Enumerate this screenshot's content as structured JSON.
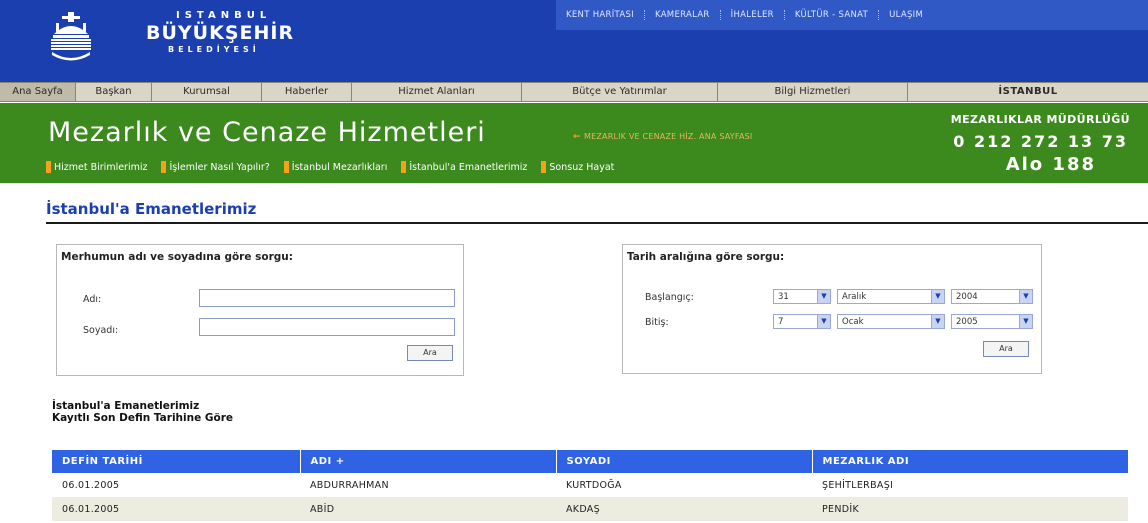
{
  "header": {
    "brand_line1": "ISTANBUL",
    "brand_line2": "BÜYÜKŞEHİR",
    "brand_line3": "BELEDİYESİ",
    "toplinks": [
      "KENT HARİTASI",
      "KAMERALAR",
      "İHALELER",
      "KÜLTÜR - SANAT",
      "ULAŞIM"
    ]
  },
  "nav": {
    "items": [
      "Ana Sayfa",
      "Başkan",
      "Kurumsal",
      "Haberler",
      "Hizmet Alanları",
      "Bütçe ve Yatırımlar",
      "Bilgi Hizmetleri",
      "İSTANBUL"
    ]
  },
  "section": {
    "title": "Mezarlık ve Cenaze Hizmetleri",
    "home_link": "MEZARLIK VE CENAZE HİZ. ANA SAYFASI",
    "subnav": [
      "Hizmet Birimlerimiz",
      "İşlemler Nasıl Yapılır?",
      "İstanbul Mezarlıkları",
      "İstanbul'a Emanetlerimiz",
      "Sonsuz Hayat"
    ],
    "dept": "MEZARLIKLAR MÜDÜRLÜĞÜ",
    "phone": "0 212 272 13 73",
    "alo": "Alo 188"
  },
  "page": {
    "title": "İstanbul'a Emanetlerimiz"
  },
  "search_by_name": {
    "title": "Merhumun adı ve soyadına göre sorgu:",
    "first_name_label": "Adı:",
    "first_name_value": "",
    "last_name_label": "Soyadı:",
    "last_name_value": "",
    "button": "Ara"
  },
  "search_by_date": {
    "title": "Tarih aralığına göre sorgu:",
    "start_label": "Başlangıç:",
    "end_label": "Bitiş:",
    "start_day": "31",
    "start_month": "Aralık",
    "start_year": "2004",
    "end_day": "7",
    "end_month": "Ocak",
    "end_year": "2005",
    "button": "Ara"
  },
  "results": {
    "heading1": "İstanbul'a Emanetlerimiz",
    "heading2": "Kayıtlı Son Defin Tarihine Göre",
    "columns": [
      "DEFİN TARİHİ",
      "ADI +",
      "SOYADI",
      "MEZARLIK ADI"
    ],
    "rows": [
      [
        "06.01.2005",
        "ABDURRAHMAN",
        "KURTDOĞA",
        "ŞEHİTLERBAŞI"
      ],
      [
        "06.01.2005",
        "ABİD",
        "AKDAŞ",
        "PENDİK"
      ]
    ]
  },
  "colors": {
    "header_blue": "#1b3fae",
    "section_green": "#3c8a1e",
    "accent_orange": "#f5a21a",
    "table_header": "#2f63e3"
  }
}
